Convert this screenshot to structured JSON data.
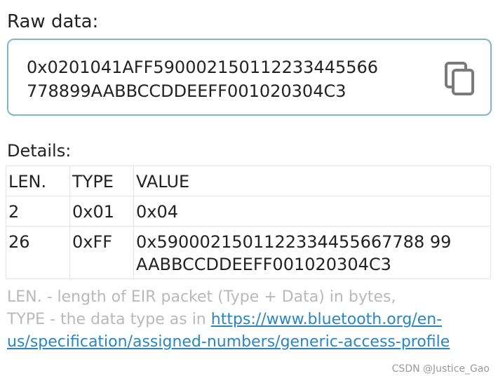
{
  "raw": {
    "title": "Raw data:",
    "value": "0x0201041AFF5900021501122334455667788 99AABBCCDDEEFF001020304C3",
    "value_line1": "0x0201041AFF590002150112233445566",
    "value_line2": "778899AABBCCDDEEFF001020304C3",
    "copy_icon": "copy-icon"
  },
  "details": {
    "title": "Details:",
    "headers": [
      "LEN.",
      "TYPE",
      "VALUE"
    ],
    "rows": [
      {
        "len": "2",
        "type": "0x01",
        "value": "0x04"
      },
      {
        "len": "26",
        "type": "0xFF",
        "value_line1": "0x5900021501122334455667788 99",
        "value_line2": "AABBCCDDEEFF001020304C3"
      }
    ]
  },
  "legend": {
    "line1": "LEN. - length of EIR packet (Type + Data) in bytes,",
    "line2_prefix": "TYPE - the data type as in ",
    "link": "https://www.bluetooth.org/en-us/specification/assigned-numbers/generic-access-profile"
  },
  "watermark": "CSDN @Justice_Gao"
}
